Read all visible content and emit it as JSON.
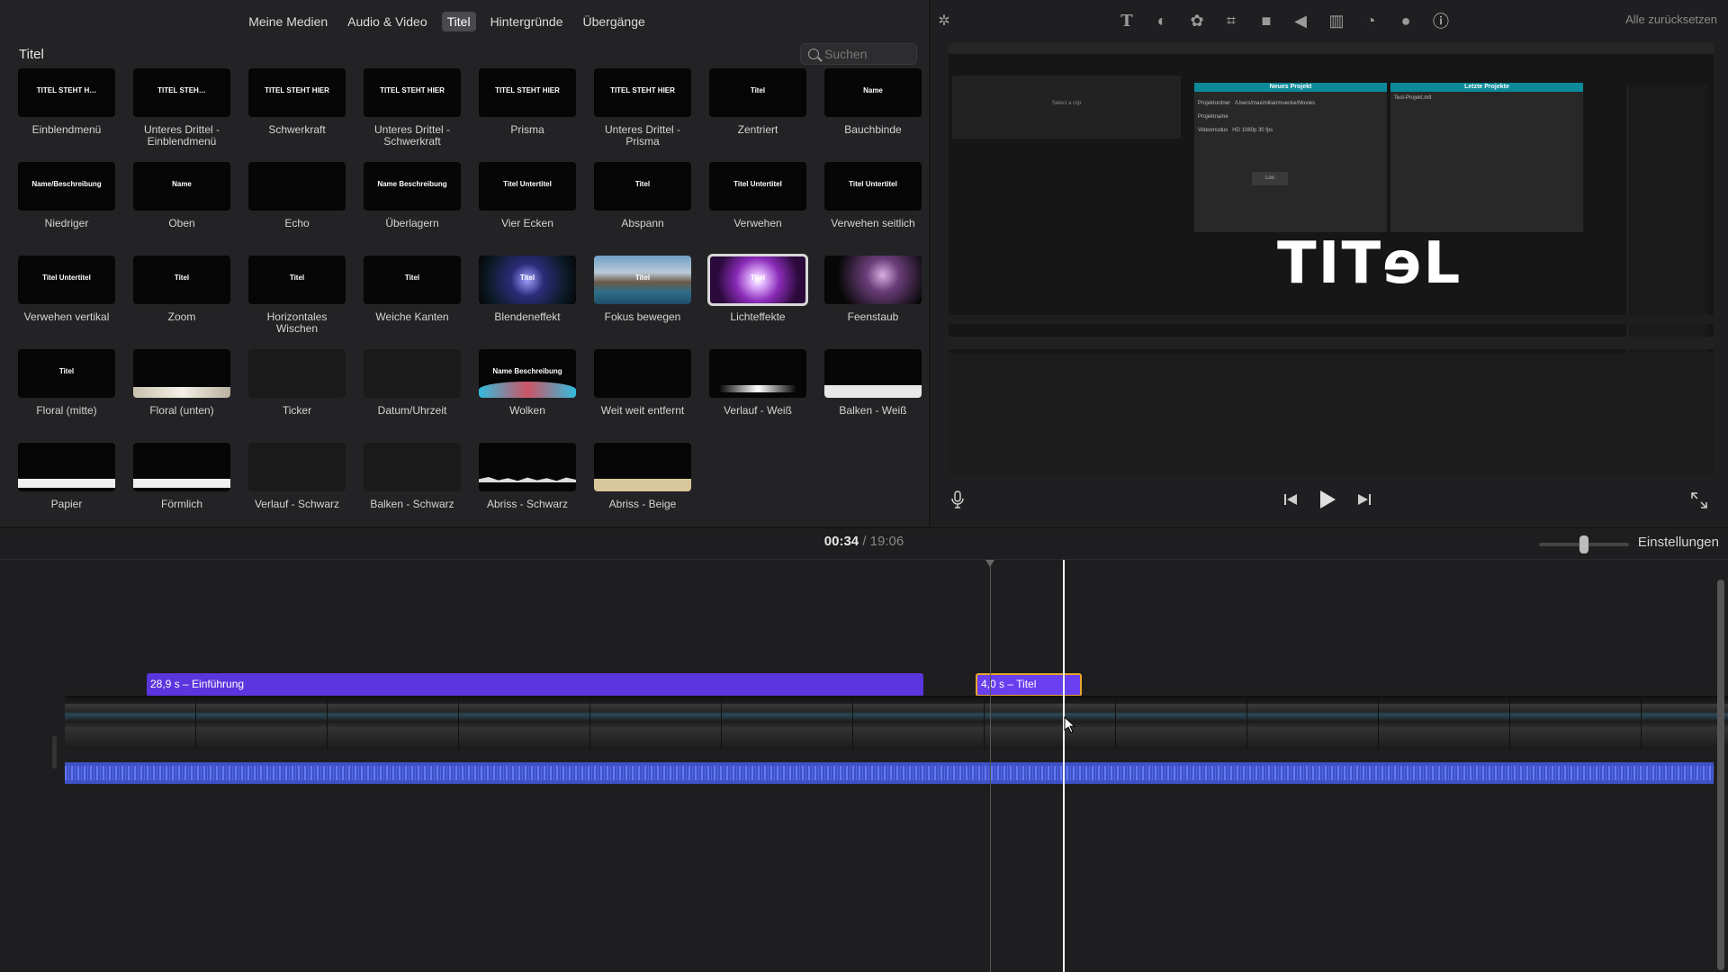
{
  "browser": {
    "tabs": [
      "Meine Medien",
      "Audio & Video",
      "Titel",
      "Hintergründe",
      "Übergänge"
    ],
    "active_tab": 2,
    "title": "Titel",
    "search_placeholder": "Suchen",
    "tiles": [
      {
        "name": "Einblendmenü",
        "thumb": "TITEL STEHT H…"
      },
      {
        "name": "Unteres Drittel - Einblendmenü",
        "thumb": "TITEL STEH…"
      },
      {
        "name": "Schwerkraft",
        "thumb": "TITEL STEHT HIER"
      },
      {
        "name": "Unteres Drittel - Schwerkraft",
        "thumb": "TITEL STEHT HIER"
      },
      {
        "name": "Prisma",
        "thumb": "TITEL STEHT HIER"
      },
      {
        "name": "Unteres Drittel - Prisma",
        "thumb": "TITEL STEHT HIER"
      },
      {
        "name": "Zentriert",
        "thumb": "Titel"
      },
      {
        "name": "Bauchbinde",
        "thumb": "Name"
      },
      {
        "name": "Niedriger",
        "thumb": "Name/Beschreibung"
      },
      {
        "name": "Oben",
        "thumb": "Name"
      },
      {
        "name": "Echo",
        "thumb": ""
      },
      {
        "name": "Überlagern",
        "thumb": "Name Beschreibung"
      },
      {
        "name": "Vier Ecken",
        "thumb": "Titel Untertitel"
      },
      {
        "name": "Abspann",
        "thumb": "Titel"
      },
      {
        "name": "Verwehen",
        "thumb": "Titel Untertitel"
      },
      {
        "name": "Verwehen seitlich",
        "thumb": "Titel Untertitel"
      },
      {
        "name": "Verwehen vertikal",
        "thumb": "Titel Untertitel"
      },
      {
        "name": "Zoom",
        "thumb": "Titel"
      },
      {
        "name": "Horizontales Wischen",
        "thumb": "Titel"
      },
      {
        "name": "Weiche Kanten",
        "thumb": "Titel"
      },
      {
        "name": "Blendeneffekt",
        "thumb": "Titel"
      },
      {
        "name": "Fokus bewegen",
        "thumb": "Titel"
      },
      {
        "name": "Lichteffekte",
        "thumb": "Titel"
      },
      {
        "name": "Feenstaub",
        "thumb": ""
      },
      {
        "name": "Floral (mitte)",
        "thumb": "Titel"
      },
      {
        "name": "Floral (unten)",
        "thumb": ""
      },
      {
        "name": "Ticker",
        "thumb": ""
      },
      {
        "name": "Datum/Uhrzeit",
        "thumb": ""
      },
      {
        "name": "Wolken",
        "thumb": "Name Beschreibung"
      },
      {
        "name": "Weit weit entfernt",
        "thumb": ""
      },
      {
        "name": "Verlauf - Weiß",
        "thumb": ""
      },
      {
        "name": "Balken - Weiß",
        "thumb": ""
      },
      {
        "name": "Papier",
        "thumb": ""
      },
      {
        "name": "Förmlich",
        "thumb": ""
      },
      {
        "name": "Verlauf - Schwarz",
        "thumb": ""
      },
      {
        "name": "Balken - Schwarz",
        "thumb": ""
      },
      {
        "name": "Abriss - Schwarz",
        "thumb": ""
      },
      {
        "name": "Abriss - Beige",
        "thumb": ""
      }
    ],
    "selected_tile": 22
  },
  "viewer": {
    "reset_label": "Alle zurücksetzen",
    "tool_icons": [
      "magic-wand-icon",
      "text-icon",
      "color-balance-icon",
      "color-palette-icon",
      "crop-icon",
      "camera-icon",
      "volume-icon",
      "equalizer-icon",
      "speed-icon",
      "filter-icon",
      "info-icon"
    ],
    "preview_title": "TITɘL",
    "preview_clip": "Select a clip",
    "panel_new": "Neues Projekt",
    "panel_recent": "Letzte Projekte",
    "panel_recent_item": "Test-Projekt.mlt",
    "panel_rows": [
      "Projektordner",
      "Projektname",
      "Videomodus"
    ],
    "panel_values": [
      "/Users/maximilianmuecke/Movies",
      "",
      "HD 1080p 30 fps"
    ],
    "panel_button": "Los"
  },
  "timeline": {
    "current_time": "00:34",
    "separator": "/",
    "total_time": "19:06",
    "settings_label": "Einstellungen",
    "clips": [
      {
        "label": "28,9 s – Einführung"
      },
      {
        "label": "4,0 s – Titel"
      }
    ],
    "zoom_level": 0.5
  },
  "colors": {
    "accent_purple": "#5b35dd",
    "selection_orange": "#e6a52a",
    "audio_blue": "#3e52c6",
    "teal": "#0b8a9a"
  }
}
